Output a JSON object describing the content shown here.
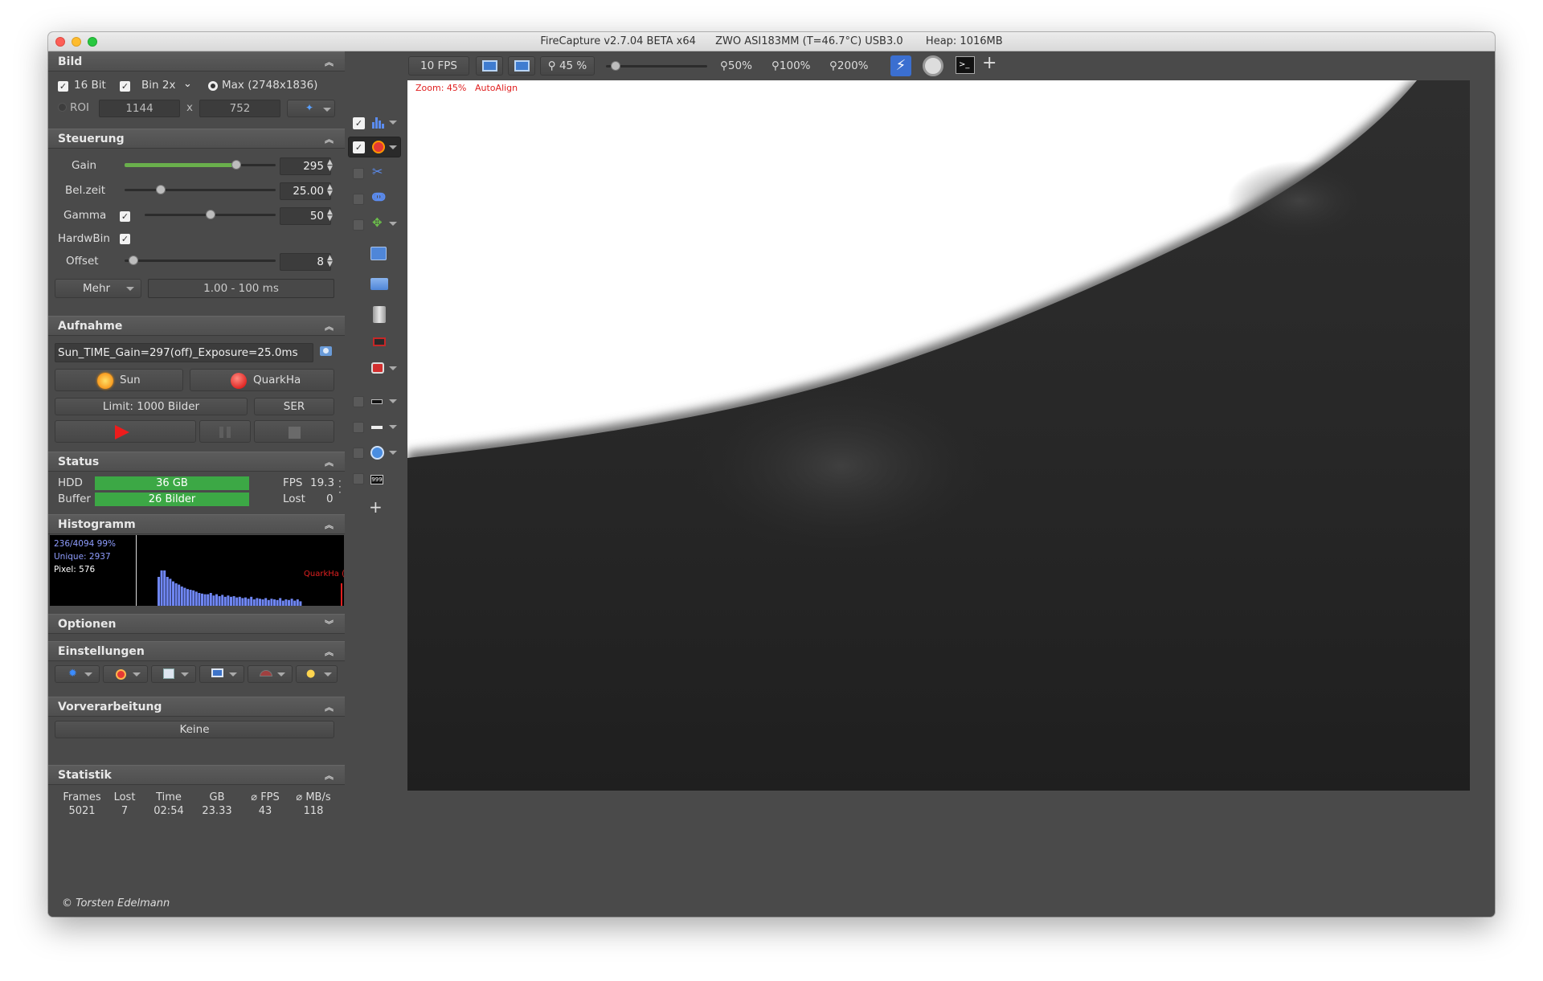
{
  "window": {
    "title": "FireCapture v2.7.04 BETA x64",
    "camera": "ZWO ASI183MM (T=46.7°C) USB3.0",
    "heap": "Heap: 1016MB"
  },
  "bild": {
    "title": "Bild",
    "bit16_label": "16 Bit",
    "bin_label": "Bin 2x",
    "max_label": "Max (2748x1836)",
    "roi_label": "ROI",
    "roi_w": "1144",
    "roi_x": "x",
    "roi_h": "752"
  },
  "steuerung": {
    "title": "Steuerung",
    "gain_label": "Gain",
    "gain_value": "295",
    "gain_level": 0.74,
    "belzeit_label": "Bel.zeit",
    "belzeit_value": "25.00",
    "belzeit_level": 0.24,
    "gamma_label": "Gamma",
    "gamma_value": "50",
    "gamma_level": 0.5,
    "hardwbin_label": "HardwBin",
    "offset_label": "Offset",
    "offset_value": "8",
    "offset_level": 0.06,
    "mehr_label": "Mehr",
    "range_label": "1.00 - 100 ms"
  },
  "aufnahme": {
    "title": "Aufnahme",
    "filename": "Sun_TIME_Gain=297(off)_Exposure=25.0ms",
    "sun_label": "Sun",
    "quarkha_label": "QuarkHa",
    "limit_label": "Limit: 1000 Bilder",
    "format_label": "SER"
  },
  "status": {
    "title": "Status",
    "hdd_label": "HDD",
    "hdd_value": "36 GB",
    "buffer_label": "Buffer",
    "buffer_value": "26  Bilder",
    "fps_label": "FPS",
    "fps_value": "19.3",
    "lost_label": "Lost",
    "lost_value": "0"
  },
  "histogramm": {
    "title": "Histogramm",
    "line1": "236/4094 99%",
    "line2": "Unique: 2937",
    "line3": "Pixel: 576",
    "profile_label": "QuarkHa (",
    "bars": [
      0.45,
      0.55,
      0.55,
      0.45,
      0.42,
      0.38,
      0.35,
      0.33,
      0.3,
      0.28,
      0.26,
      0.25,
      0.24,
      0.22,
      0.2,
      0.19,
      0.18,
      0.18,
      0.2,
      0.16,
      0.18,
      0.15,
      0.17,
      0.14,
      0.16,
      0.14,
      0.15,
      0.13,
      0.14,
      0.12,
      0.13,
      0.11,
      0.14,
      0.1,
      0.12,
      0.11,
      0.1,
      0.12,
      0.09,
      0.11,
      0.1,
      0.09,
      0.12,
      0.08,
      0.1,
      0.09,
      0.11,
      0.08,
      0.1,
      0.07
    ]
  },
  "optionen": {
    "title": "Optionen"
  },
  "einstellungen": {
    "title": "Einstellungen"
  },
  "vorverarbeitung": {
    "title": "Vorverarbeitung",
    "value": "Keine"
  },
  "statistik": {
    "title": "Statistik",
    "headers": [
      "Frames",
      "Lost",
      "Time",
      "GB",
      "⌀ FPS",
      "⌀ MB/s"
    ],
    "values": [
      "5021",
      "7",
      "02:54",
      "23.33",
      "43",
      "118"
    ]
  },
  "footer": "© Torsten Edelmann",
  "toolbar": {
    "fps_label": "10 FPS",
    "zoom_value": "45 %",
    "zoom50": "50%",
    "zoom100": "100%",
    "zoom200": "200%"
  },
  "viewer": {
    "zoom_label": "Zoom: 45%",
    "autoalign_label": "AutoAlign"
  }
}
